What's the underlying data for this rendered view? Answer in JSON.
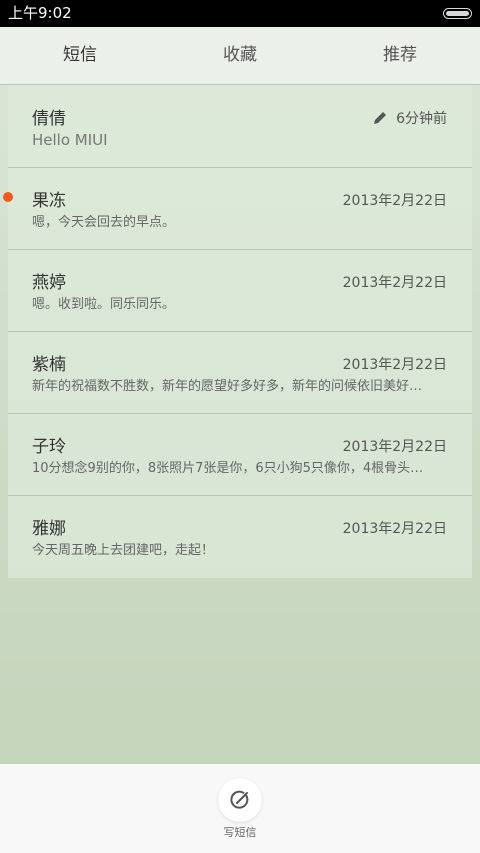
{
  "status_bar": {
    "time": "上午9:02"
  },
  "tabs": [
    {
      "label": "短信",
      "active": true
    },
    {
      "label": "收藏",
      "active": false
    },
    {
      "label": "推荐",
      "active": false
    }
  ],
  "conversations": [
    {
      "name": "倩倩",
      "date": "6分钟前",
      "preview": "Hello MIUI",
      "draft": true,
      "unread": false
    },
    {
      "name": "果冻",
      "date": "2013年2月22日",
      "preview": "嗯，今天会回去的早点。",
      "draft": false,
      "unread": false
    },
    {
      "name": "燕婷",
      "date": "2013年2月22日",
      "preview": "嗯。收到啦。同乐同乐。",
      "draft": false,
      "unread": true
    },
    {
      "name": "紫楠",
      "date": "2013年2月22日",
      "preview": "新年的祝福数不胜数，新年的愿望好多好多，新年的问候依旧美好…",
      "draft": false,
      "unread": false
    },
    {
      "name": "子玲",
      "date": "2013年2月22日",
      "preview": "10分想念9别的你，8张照片7张是你，6只小狗5只像你，4根骨头…",
      "draft": false,
      "unread": false
    },
    {
      "name": "雅娜",
      "date": "2013年2月22日",
      "preview": "今天周五晚上去团建吧，走起！",
      "draft": false,
      "unread": false
    }
  ],
  "compose": {
    "label": "写短信",
    "icon": "compose-icon"
  },
  "colors": {
    "unread_dot": "#f05a22",
    "status_bar": "#000000"
  }
}
